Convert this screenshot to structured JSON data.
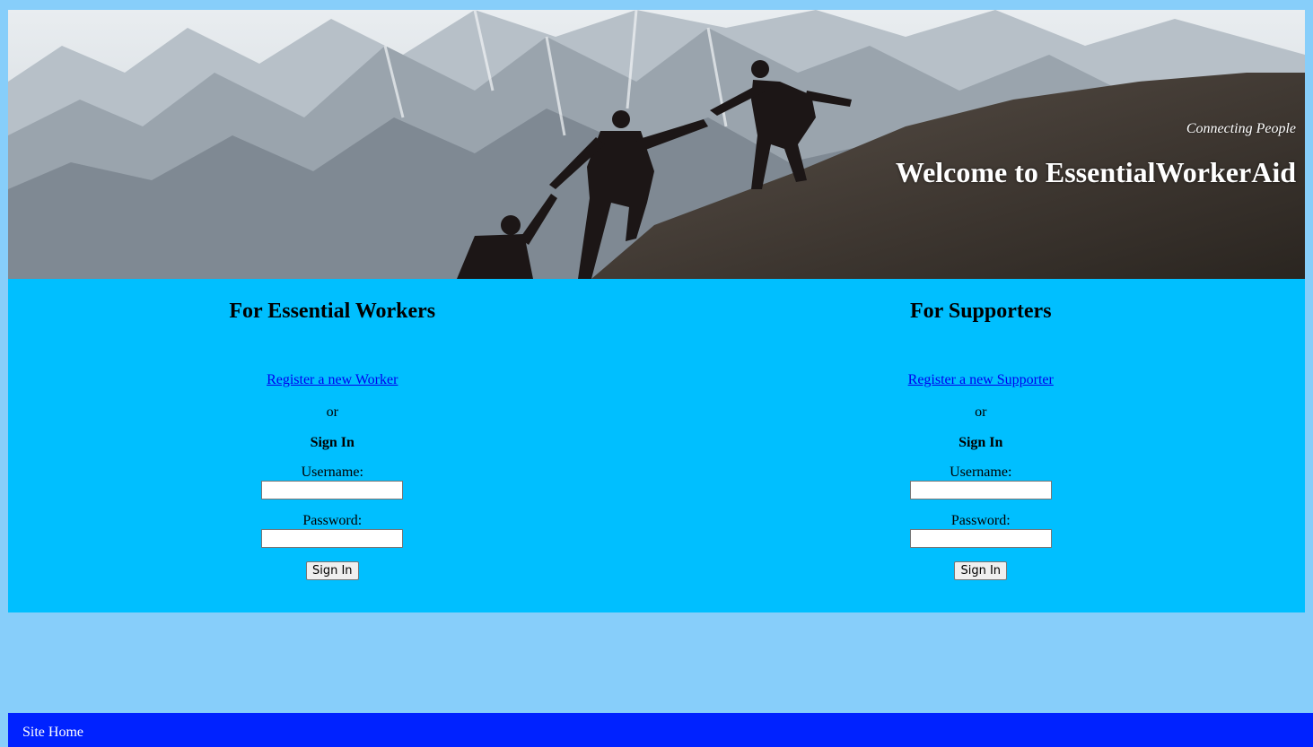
{
  "header": {
    "tagline": "Connecting People",
    "title": "Welcome to EssentialWorkerAid",
    "banner_image": "mountain-climbers-helping-hand"
  },
  "workers": {
    "heading": "For Essential Workers",
    "register_link": "Register a new Worker",
    "or_text": "or",
    "signin_title": "Sign In",
    "username_label": "Username:",
    "password_label": "Password:",
    "signin_button": "Sign In"
  },
  "supporters": {
    "heading": "For Supporters",
    "register_link": "Register a new Supporter",
    "or_text": "or",
    "signin_title": "Sign In",
    "username_label": "Username:",
    "password_label": "Password:",
    "signin_button": "Sign In"
  },
  "footer": {
    "home_link": "Site Home"
  },
  "colors": {
    "page_background": "#87cefa",
    "panel_background": "#00bfff",
    "footer_background": "#0022ff",
    "link": "#0000ee"
  }
}
